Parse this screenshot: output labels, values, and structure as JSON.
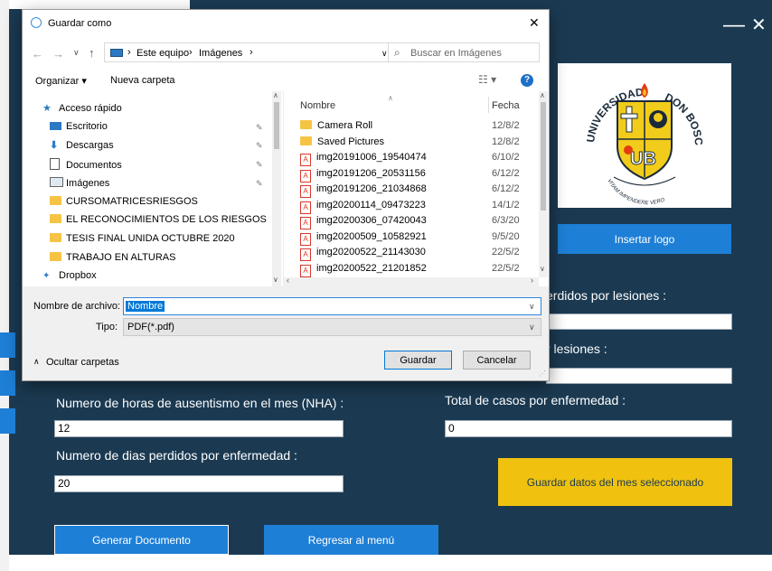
{
  "background_app": {
    "window_controls": {
      "minimize": "—",
      "close": "✕"
    },
    "logo_text": {
      "top": "UNIVERSIDAD DON BOSCO",
      "motto": "VITAM IMPENDERE VERO"
    },
    "insert_logo_button": "Insertar logo",
    "label_days_lost_injuries": "erdidos por lesiones :",
    "label_cases_injuries": "r lesiones :",
    "label_nha": "Numero de horas de ausentismo en el mes (NHA) :",
    "value_nha": "12",
    "label_total_cases_illness": "Total de casos por enfermedad :",
    "value_total_cases_illness": "0",
    "label_days_lost_illness": "Numero de dias perdidos por enfermedad :",
    "value_days_lost_illness": "20",
    "save_month_button": "Guardar datos del mes seleccionado",
    "generate_doc_button": "Generar Documento",
    "back_menu_button": "Regresar al menú"
  },
  "dialog": {
    "title": "Guardar como",
    "close": "✕",
    "breadcrumb": [
      "Este equipo",
      "Imágenes"
    ],
    "search_placeholder": "Buscar en Imágenes",
    "organize_label": "Organizar ▾",
    "new_folder_label": "Nueva carpeta",
    "nav_items": [
      {
        "label": "Acceso rápido",
        "icon": "star-icon",
        "pinned": false,
        "indent": 0
      },
      {
        "label": "Escritorio",
        "icon": "desktop-icon",
        "pinned": true,
        "indent": 1
      },
      {
        "label": "Descargas",
        "icon": "download-icon",
        "pinned": true,
        "indent": 1
      },
      {
        "label": "Documentos",
        "icon": "document-icon",
        "pinned": true,
        "indent": 1
      },
      {
        "label": "Imágenes",
        "icon": "pictures-icon",
        "pinned": true,
        "indent": 1
      },
      {
        "label": "CURSOMATRICESRIESGOS",
        "icon": "folder-icon",
        "pinned": false,
        "indent": 1
      },
      {
        "label": "EL RECONOCIMIENTOS DE LOS RIESGOS",
        "icon": "folder-icon",
        "pinned": false,
        "indent": 1
      },
      {
        "label": "TESIS FINAL UNIDA OCTUBRE 2020",
        "icon": "folder-icon",
        "pinned": false,
        "indent": 1
      },
      {
        "label": "TRABAJO EN ALTURAS",
        "icon": "folder-icon",
        "pinned": false,
        "indent": 1
      },
      {
        "label": "Dropbox",
        "icon": "dropbox-icon",
        "pinned": false,
        "indent": 0
      }
    ],
    "columns": {
      "name": "Nombre",
      "date": "Fecha"
    },
    "files": [
      {
        "name": "Camera Roll",
        "date": "12/8/2",
        "type": "folder"
      },
      {
        "name": "Saved Pictures",
        "date": "12/8/2",
        "type": "folder"
      },
      {
        "name": "img20191006_19540474",
        "date": "6/10/2",
        "type": "pdf"
      },
      {
        "name": "img20191206_20531156",
        "date": "6/12/2",
        "type": "pdf"
      },
      {
        "name": "img20191206_21034868",
        "date": "6/12/2",
        "type": "pdf"
      },
      {
        "name": "img20200114_09473223",
        "date": "14/1/2",
        "type": "pdf"
      },
      {
        "name": "img20200306_07420043",
        "date": "6/3/20",
        "type": "pdf"
      },
      {
        "name": "img20200509_10582921",
        "date": "9/5/20",
        "type": "pdf"
      },
      {
        "name": "img20200522_21143030",
        "date": "22/5/2",
        "type": "pdf"
      },
      {
        "name": "img20200522_21201852",
        "date": "22/5/2",
        "type": "pdf"
      }
    ],
    "filename_label": "Nombre de archivo:",
    "filename_value": "Nombre",
    "type_label": "Tipo:",
    "type_value": "PDF(*.pdf)",
    "hide_folders_label": "Ocultar carpetas",
    "save_button": "Guardar",
    "cancel_button": "Cancelar",
    "colors": {
      "accent": "#1e7fd6",
      "app_bg": "#1b3a52",
      "yellow_button": "#f0c20f"
    }
  }
}
